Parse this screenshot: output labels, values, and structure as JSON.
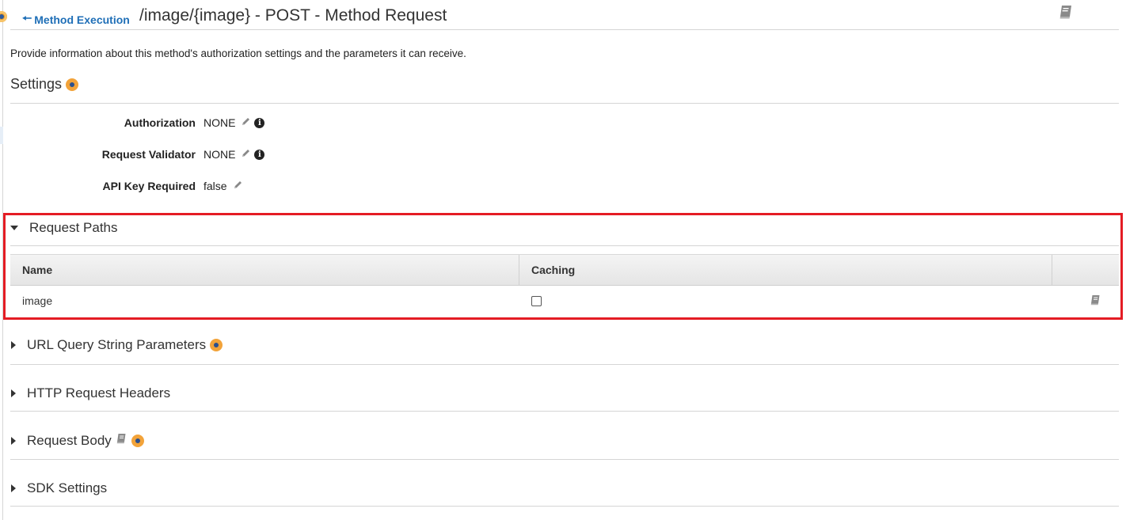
{
  "header": {
    "back_label": "Method Execution",
    "title": "/image/{image} - POST - Method Request"
  },
  "description": "Provide information about this method's authorization settings and the parameters it can receive.",
  "settings": {
    "title": "Settings",
    "rows": [
      {
        "label": "Authorization",
        "value": "NONE"
      },
      {
        "label": "Request Validator",
        "value": "NONE"
      },
      {
        "label": "API Key Required",
        "value": "false"
      }
    ]
  },
  "request_paths": {
    "title": "Request Paths",
    "columns": [
      "Name",
      "Caching"
    ],
    "rows": [
      {
        "name": "image",
        "caching": false
      }
    ]
  },
  "sections": [
    {
      "title": "URL Query String Parameters"
    },
    {
      "title": "HTTP Request Headers"
    },
    {
      "title": "Request Body"
    },
    {
      "title": "SDK Settings"
    }
  ],
  "icons": {
    "back": "arrow-left-icon",
    "doc": "book-icon",
    "edit": "pencil-icon",
    "info": "info-icon",
    "help": "help-badge-icon"
  },
  "colors": {
    "link": "#1f6fb7",
    "highlight": "#e41c24",
    "badge": "#f2a33a"
  }
}
